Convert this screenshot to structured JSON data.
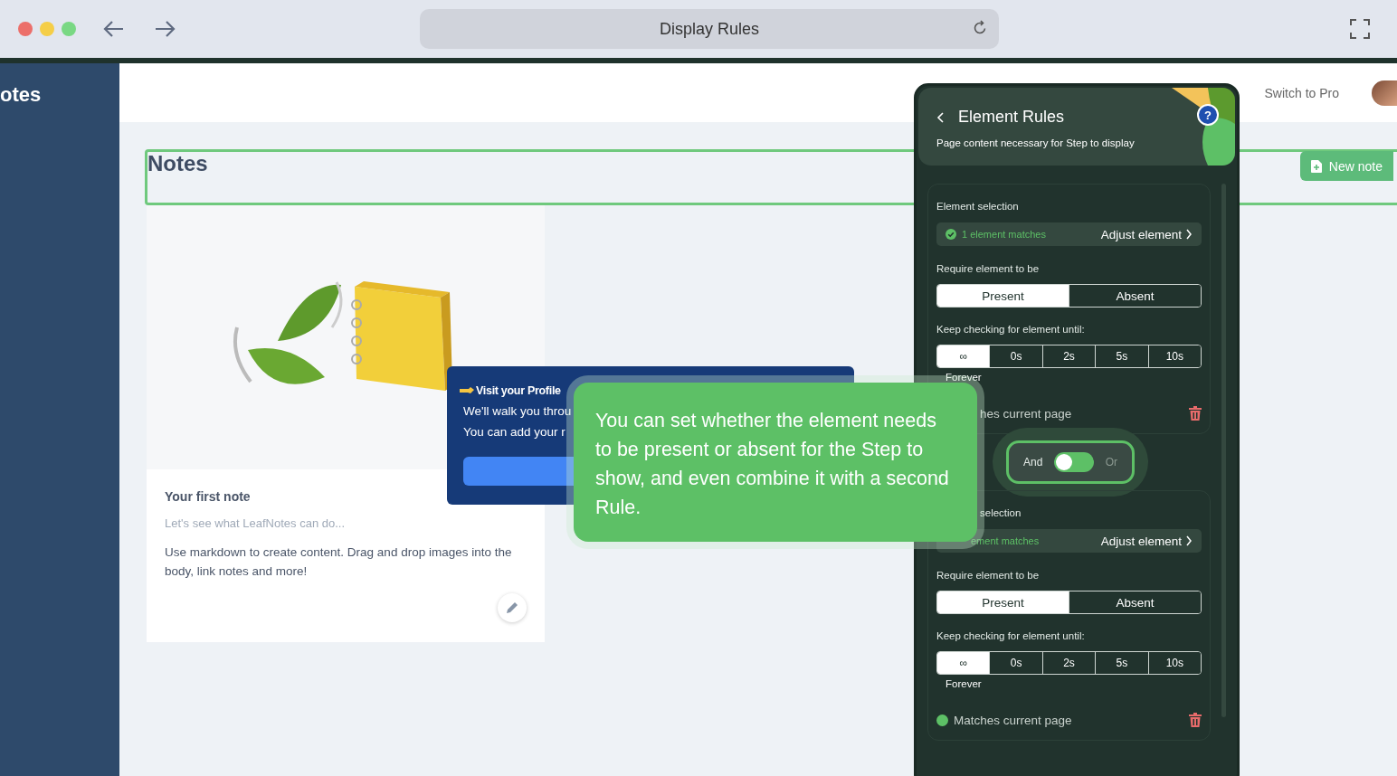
{
  "browser": {
    "title": "Display Rules"
  },
  "sidebar": {
    "brand": "otes"
  },
  "header": {
    "link": "Switch to Pro"
  },
  "notes": {
    "heading": "Notes",
    "new_button": "New note",
    "card": {
      "title": "Your first note",
      "subtitle": "Let's see what LeafNotes can do...",
      "body": "Use markdown to create content. Drag and drop images into the body, link notes and more!"
    }
  },
  "tour_popup": {
    "title": "Visit your Profile",
    "lines": [
      "We'll walk you throu",
      "You can add your r"
    ]
  },
  "tooltip": {
    "text": "You can set whether the element needs to be present or absent for the Step to show, and even combine it with a second Rule."
  },
  "panel": {
    "title": "Element Rules",
    "subtitle": "Page content necessary for Step to display",
    "rules": [
      {
        "covered": false,
        "selection_label": "Element selection",
        "match_text": "1 element matches",
        "adjust": "Adjust element",
        "require_label": "Require element to be",
        "presence": [
          {
            "label": "Present",
            "selected": true
          },
          {
            "label": "Absent",
            "selected": false
          }
        ],
        "timing_label": "Keep checking for element until:",
        "timing": [
          {
            "label": "∞",
            "selected": true
          },
          {
            "label": "0s",
            "selected": false
          },
          {
            "label": "2s",
            "selected": false
          },
          {
            "label": "5s",
            "selected": false
          },
          {
            "label": "10s",
            "selected": false
          }
        ],
        "timing_caption": "Forever",
        "status": {
          "text": "hes current page",
          "dot": false
        }
      },
      {
        "covered": true,
        "selection_label": "selection",
        "match_text": "ement matches",
        "adjust": "Adjust element",
        "require_label": "Require element to be",
        "presence": [
          {
            "label": "Present",
            "selected": true
          },
          {
            "label": "Absent",
            "selected": false
          }
        ],
        "timing_label": "Keep checking for element until:",
        "timing": [
          {
            "label": "∞",
            "selected": true
          },
          {
            "label": "0s",
            "selected": false
          },
          {
            "label": "2s",
            "selected": false
          },
          {
            "label": "5s",
            "selected": false
          },
          {
            "label": "10s",
            "selected": false
          }
        ],
        "timing_caption": "Forever",
        "status": {
          "text": "Matches current page",
          "dot": true
        }
      }
    ],
    "combinator": {
      "left": "And",
      "right": "Or",
      "on": false
    },
    "help": "?"
  }
}
